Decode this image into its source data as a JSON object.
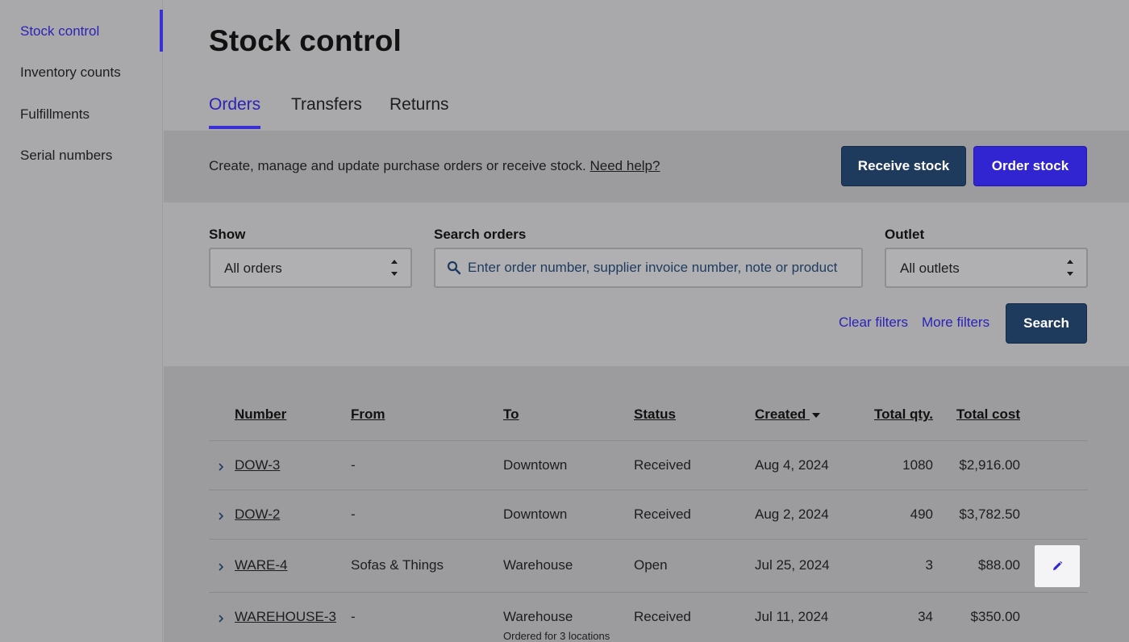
{
  "sidebar": {
    "items": [
      {
        "label": "Stock control"
      },
      {
        "label": "Inventory counts"
      },
      {
        "label": "Fulfillments"
      },
      {
        "label": "Serial numbers"
      }
    ]
  },
  "header": {
    "title": "Stock control",
    "tabs": [
      {
        "label": "Orders"
      },
      {
        "label": "Transfers"
      },
      {
        "label": "Returns"
      }
    ]
  },
  "banner": {
    "text": "Create, manage and update purchase orders or receive stock.",
    "help_link": "Need help?",
    "receive_label": "Receive stock",
    "order_label": "Order stock"
  },
  "filters": {
    "show_label": "Show",
    "show_value": "All orders",
    "search_label": "Search orders",
    "search_placeholder": "Enter order number, supplier invoice number, note or product",
    "outlet_label": "Outlet",
    "outlet_value": "All outlets",
    "clear_label": "Clear filters",
    "more_label": "More filters",
    "search_button": "Search"
  },
  "table": {
    "columns": {
      "number": "Number",
      "from": "From",
      "to": "To",
      "status": "Status",
      "created": "Created",
      "qty": "Total qty.",
      "cost": "Total cost"
    },
    "rows": [
      {
        "number": "DOW-3",
        "from": "-",
        "to": "Downtown",
        "status": "Received",
        "created": "Aug 4, 2024",
        "qty": "1080",
        "cost": "$2,916.00",
        "note": ""
      },
      {
        "number": "DOW-2",
        "from": "-",
        "to": "Downtown",
        "status": "Received",
        "created": "Aug 2, 2024",
        "qty": "490",
        "cost": "$3,782.50",
        "note": ""
      },
      {
        "number": "WARE-4",
        "from": "Sofas & Things",
        "to": "Warehouse",
        "status": "Open",
        "created": "Jul 25, 2024",
        "qty": "3",
        "cost": "$88.00",
        "note": ""
      },
      {
        "number": "WAREHOUSE-3",
        "from": "-",
        "to": "Warehouse",
        "status": "Received",
        "created": "Jul 11, 2024",
        "qty": "34",
        "cost": "$350.00",
        "note": "Ordered for 3 locations"
      }
    ]
  },
  "colors": {
    "accent": "#3125d1",
    "navy": "#1e3a5c"
  }
}
